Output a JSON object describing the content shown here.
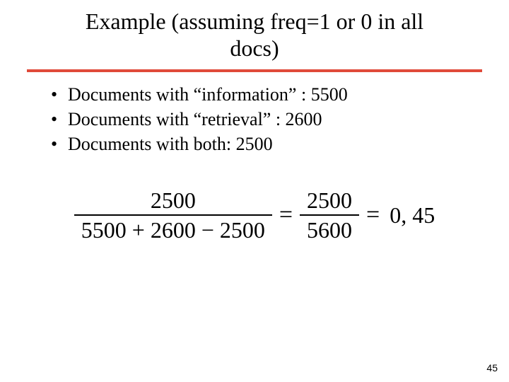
{
  "title_line1": "Example (assuming freq=1 or 0 in all",
  "title_line2": "docs)",
  "bullets": [
    "Documents with “information” : 5500",
    "Documents with “retrieval” : 2600",
    "Documents with both: 2500"
  ],
  "formula": {
    "frac1_num": "2500",
    "frac1_den": "5500 + 2600 − 2500",
    "frac2_num": "2500",
    "frac2_den": "5600",
    "equals": "=",
    "result": "0, 45"
  },
  "page_number": "45",
  "bullet_glyph": "•"
}
